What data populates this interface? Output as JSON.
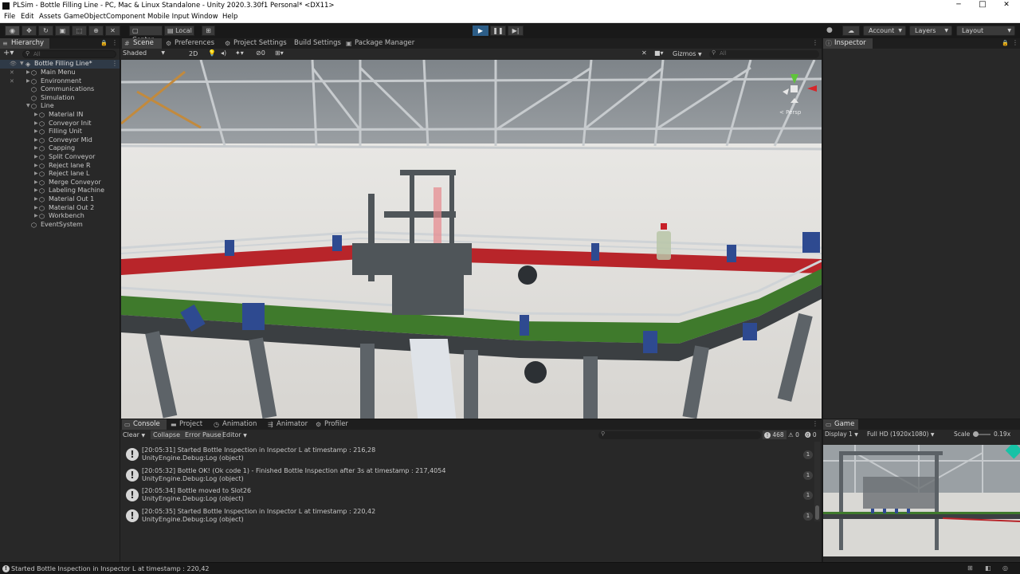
{
  "window": {
    "title": "PLSim - Bottle Filling Line - PC, Mac & Linux Standalone - Unity 2020.3.30f1 Personal* <DX11>",
    "minimize": "─",
    "maximize": "□",
    "close": "✕"
  },
  "menu": [
    "File",
    "Edit",
    "Assets",
    "GameObject",
    "Component",
    "Mobile Input",
    "Window",
    "Help"
  ],
  "toolbar": {
    "center_label": "Center",
    "local_label": "Local",
    "account_label": "Account",
    "layers_label": "Layers",
    "layout_label": "Layout"
  },
  "hierarchy": {
    "tab_label": "Hierarchy",
    "search_placeholder": "All",
    "root": "Bottle Filling Line*",
    "items": [
      {
        "label": "Main Menu",
        "indent": 1,
        "fold": true
      },
      {
        "label": "Environment",
        "indent": 1,
        "fold": true
      },
      {
        "label": "Communications",
        "indent": 1,
        "fold": false
      },
      {
        "label": "Simulation",
        "indent": 1,
        "fold": false
      },
      {
        "label": "Line",
        "indent": 1,
        "fold": true,
        "open": true
      },
      {
        "label": "Material IN",
        "indent": 2,
        "fold": true
      },
      {
        "label": "Conveyor Init",
        "indent": 2,
        "fold": true
      },
      {
        "label": "Filling Unit",
        "indent": 2,
        "fold": true
      },
      {
        "label": "Conveyor Mid",
        "indent": 2,
        "fold": true
      },
      {
        "label": "Capping",
        "indent": 2,
        "fold": true
      },
      {
        "label": "Split Conveyor",
        "indent": 2,
        "fold": true
      },
      {
        "label": "Reject lane R",
        "indent": 2,
        "fold": true
      },
      {
        "label": "Reject lane L",
        "indent": 2,
        "fold": true
      },
      {
        "label": "Merge Conveyor",
        "indent": 2,
        "fold": true
      },
      {
        "label": "Labeling Machine",
        "indent": 2,
        "fold": true
      },
      {
        "label": "Material Out 1",
        "indent": 2,
        "fold": true
      },
      {
        "label": "Material Out 2",
        "indent": 2,
        "fold": true
      },
      {
        "label": "Workbench",
        "indent": 2,
        "fold": true
      },
      {
        "label": "EventSystem",
        "indent": 1,
        "fold": false
      }
    ]
  },
  "scene": {
    "tabs": [
      "Scene",
      "Preferences",
      "Project Settings",
      "Build Settings",
      "Package Manager"
    ],
    "shading": "Shaded",
    "mode_2d": "2D",
    "fx_count": "0",
    "gizmos": "Gizmos",
    "search_placeholder": "All",
    "persp_label": "< Persp"
  },
  "inspector": {
    "tab_label": "Inspector"
  },
  "console": {
    "tabs": [
      "Console",
      "Project",
      "Animation",
      "Animator",
      "Profiler"
    ],
    "buttons": [
      "Clear",
      "Collapse",
      "Error Pause",
      "Editor"
    ],
    "info_count": "468",
    "warn_count": "0",
    "error_count": "0",
    "logs": [
      {
        "line1": "[20:05:31] Started Bottle Inspection in Inspector L at timestamp : 216,28",
        "line2": "UnityEngine.Debug:Log (object)",
        "count": "1"
      },
      {
        "line1": "[20:05:32] Bottle OK! (Ok code 1) - Finished Bottle Inspection after 3s at timestamp : 217,4054",
        "line2": "UnityEngine.Debug:Log (object)",
        "count": "1"
      },
      {
        "line1": "[20:05:34] Bottle moved to Slot26",
        "line2": "UnityEngine.Debug:Log (object)",
        "count": "1"
      },
      {
        "line1": "[20:05:35] Started Bottle Inspection in Inspector L at timestamp : 220,42",
        "line2": "UnityEngine.Debug:Log (object)",
        "count": "1"
      }
    ]
  },
  "game": {
    "tab_label": "Game",
    "display": "Display 1",
    "resolution": "Full HD (1920x1080)",
    "scale_label": "Scale",
    "scale_value": "0.19x"
  },
  "statusbar": {
    "message": "Started Bottle Inspection in Inspector L at timestamp : 220,42"
  },
  "colors": {
    "accent_blue": "#2c5d87",
    "conveyor_green": "#3f7a2c",
    "conveyor_red": "#b8252a",
    "unity_dark": "#282828"
  }
}
